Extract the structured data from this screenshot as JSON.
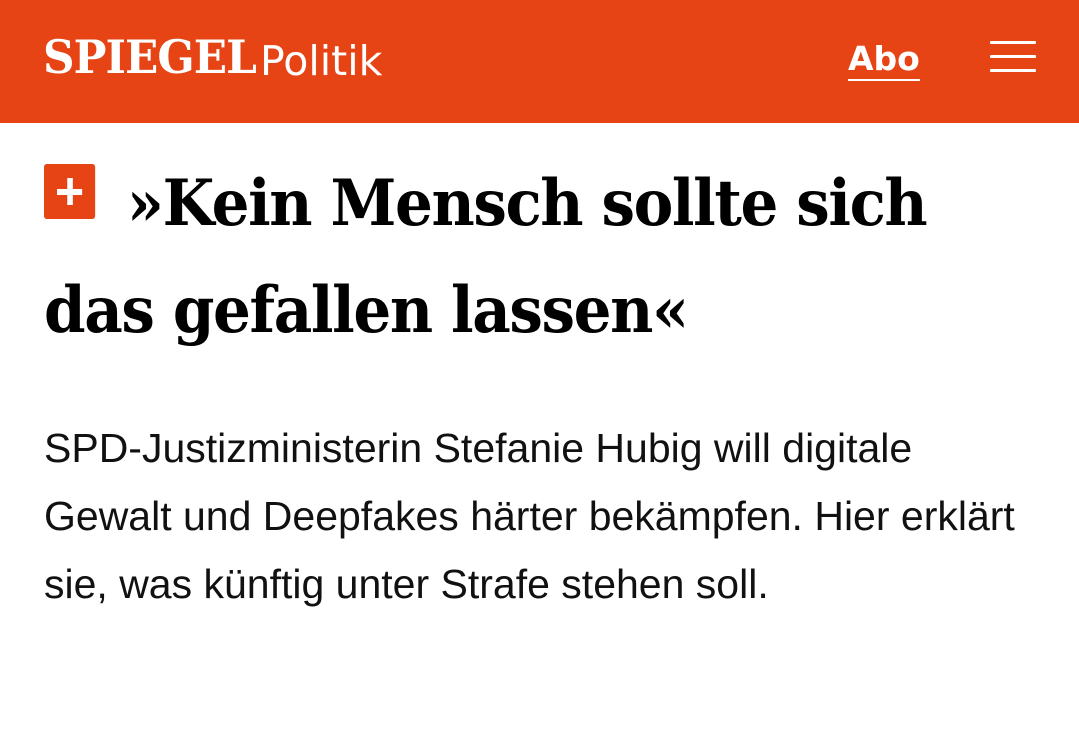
{
  "header": {
    "logo_text": "SPIEGEL",
    "section_label": "Politik",
    "abo_label": "Abo",
    "menu_icon": "hamburger-menu-icon",
    "brand_color": "#e64415"
  },
  "article": {
    "badge_icon": "spiegel-plus-icon",
    "headline": "»Kein Mensch sollte sich das gefallen lassen«",
    "teaser": "SPD-Justizministerin Stefanie Hubig will digitale Gewalt und Deepfakes härter bekämpfen. Hier erklärt sie, was künftig unter Strafe stehen soll."
  }
}
